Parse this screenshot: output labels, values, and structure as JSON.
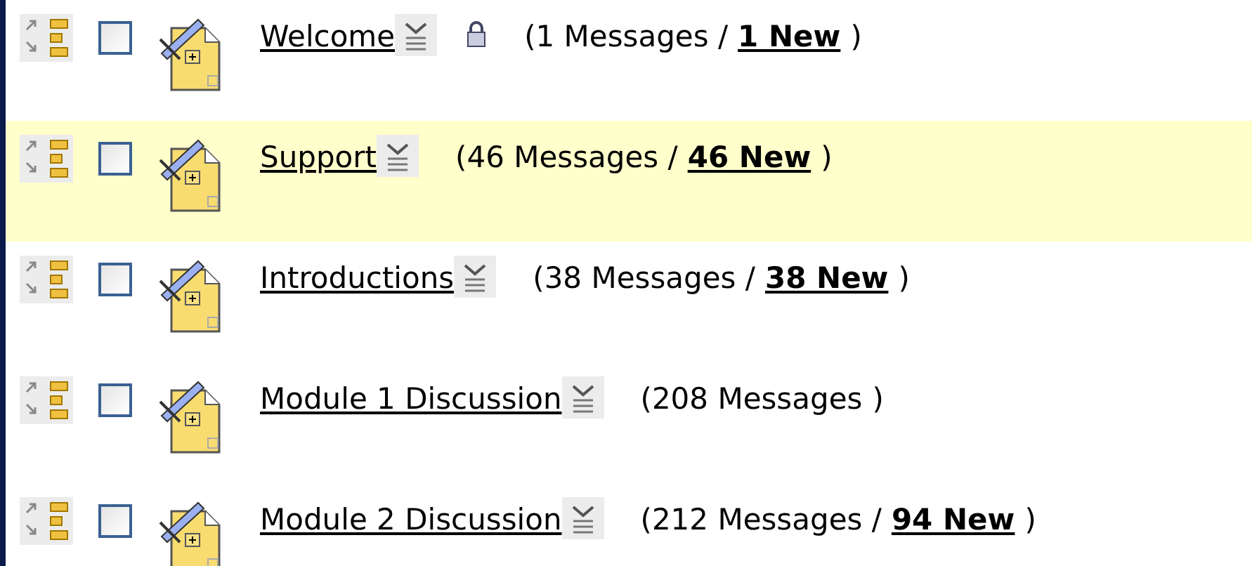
{
  "forums": [
    {
      "title": "Welcome",
      "locked": true,
      "selected": false,
      "checked": false,
      "messages": "(1 Messages /",
      "new": "1 New",
      "close": ")"
    },
    {
      "title": "Support",
      "locked": false,
      "selected": true,
      "checked": false,
      "messages": "(46 Messages /",
      "new": "46 New",
      "close": ")"
    },
    {
      "title": "Introductions",
      "locked": false,
      "selected": false,
      "checked": false,
      "messages": "(38 Messages /",
      "new": "38 New",
      "close": ")"
    },
    {
      "title": "Module 1 Discussion",
      "locked": false,
      "selected": false,
      "checked": false,
      "messages": "(208 Messages",
      "close": ")"
    },
    {
      "title": "Module 2 Discussion",
      "locked": false,
      "selected": false,
      "checked": false,
      "messages": "(212 Messages /",
      "new": "94 New",
      "close": ")"
    }
  ]
}
